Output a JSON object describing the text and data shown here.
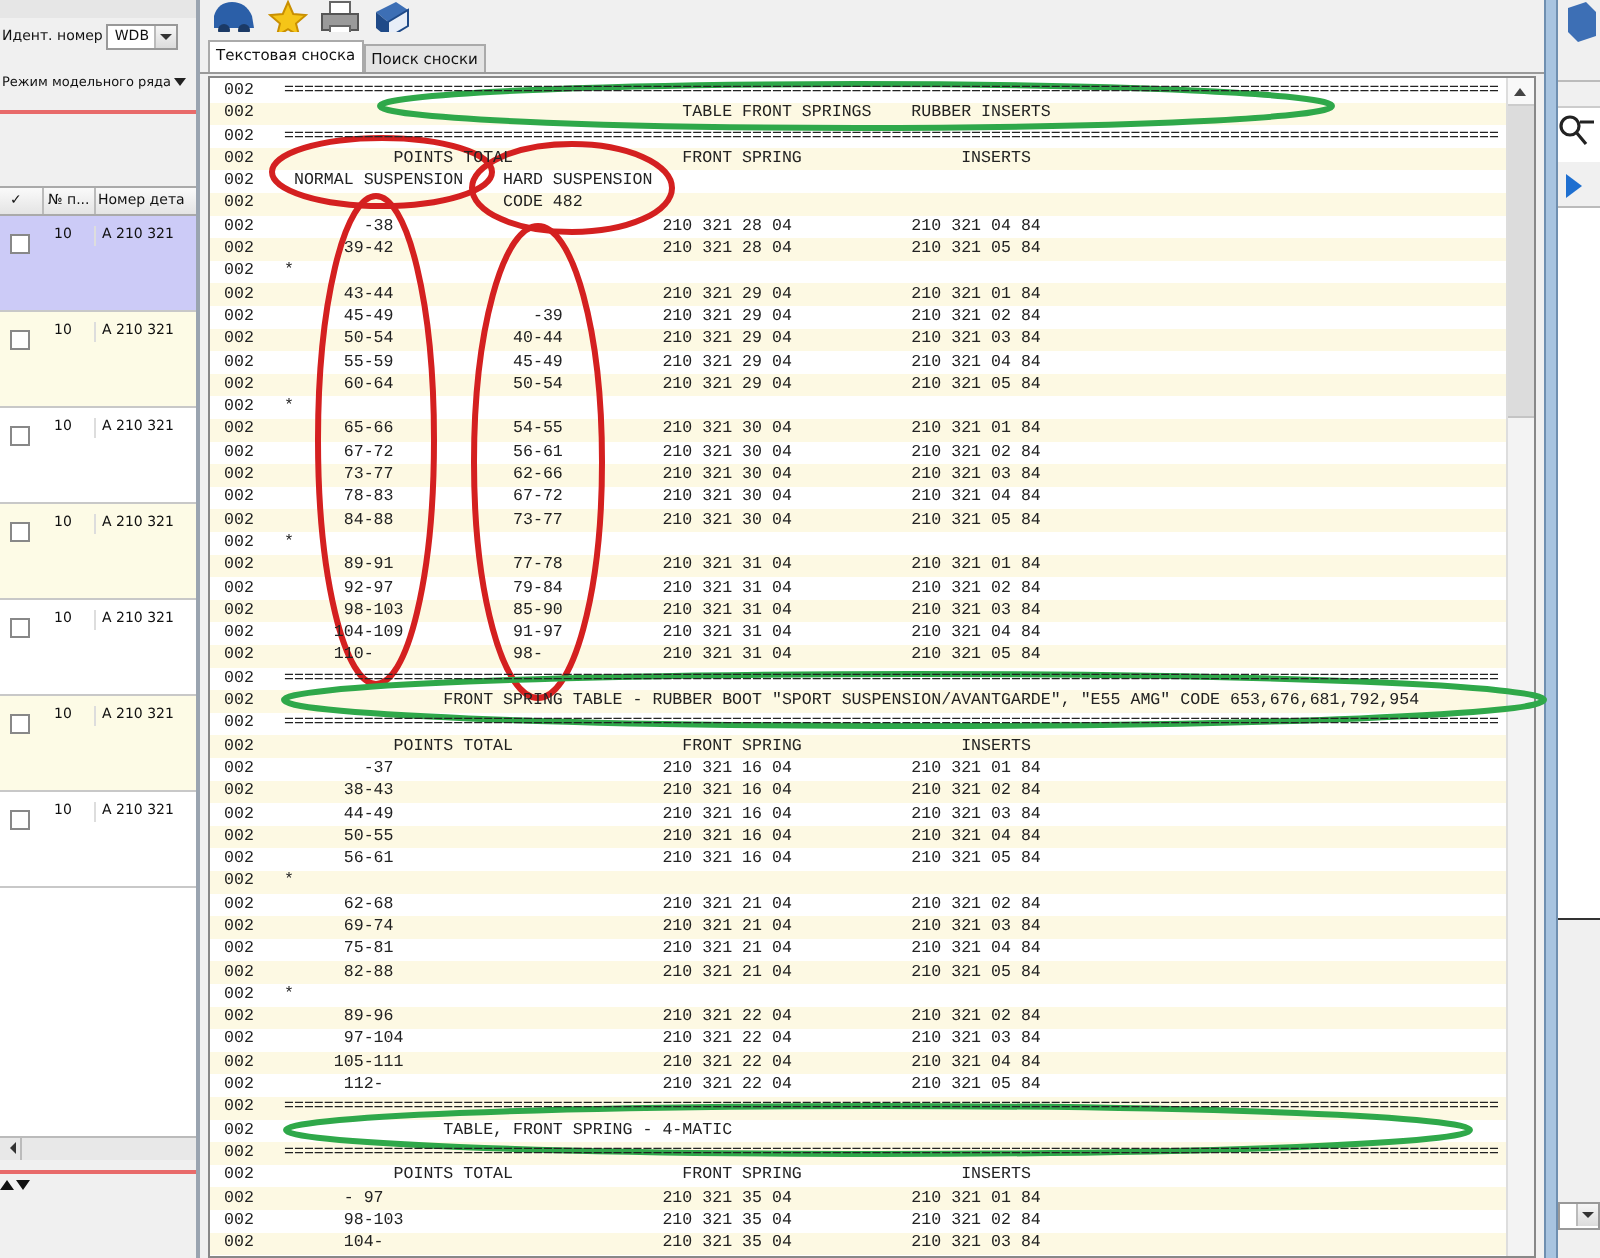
{
  "left_panel": {
    "ident_label": "Идент. номер",
    "ident_value": "WDB",
    "mode_label": "Режим модельного ряда",
    "table": {
      "columns": [
        "✓",
        "№ п...",
        "Номер дета"
      ],
      "rows": [
        {
          "number": "10",
          "part": "A 210 321",
          "checked": false,
          "selected": true
        },
        {
          "number": "10",
          "part": "A 210 321",
          "checked": false,
          "selected": false
        },
        {
          "number": "10",
          "part": "A 210 321",
          "checked": false,
          "selected": false
        },
        {
          "number": "10",
          "part": "A 210 321",
          "checked": false,
          "selected": false
        },
        {
          "number": "10",
          "part": "A 210 321",
          "checked": false,
          "selected": false
        },
        {
          "number": "10",
          "part": "A 210 321",
          "checked": false,
          "selected": false
        },
        {
          "number": "10",
          "part": "A 210 321",
          "checked": false,
          "selected": false
        }
      ]
    }
  },
  "main": {
    "tabs": [
      {
        "label": "Текстовая сноска",
        "selected": true
      },
      {
        "label": "Поиск сноски",
        "selected": false
      }
    ],
    "lines": [
      {
        "code": "002",
        "text": "=========================================================================================================================="
      },
      {
        "code": "002",
        "text": "                                        TABLE FRONT SPRINGS    RUBBER INSERTS"
      },
      {
        "code": "002",
        "text": "=========================================================================================================================="
      },
      {
        "code": "002",
        "text": "           POINTS TOTAL                 FRONT SPRING                INSERTS"
      },
      {
        "code": "002",
        "text": " NORMAL SUSPENSION    HARD SUSPENSION"
      },
      {
        "code": "002",
        "text": "                      CODE 482"
      },
      {
        "code": "002",
        "text": "        -38                           210 321 28 04            210 321 04 84"
      },
      {
        "code": "002",
        "text": "      39-42                           210 321 28 04            210 321 05 84"
      },
      {
        "code": "002",
        "text": "*"
      },
      {
        "code": "002",
        "text": "      43-44                           210 321 29 04            210 321 01 84"
      },
      {
        "code": "002",
        "text": "      45-49              -39          210 321 29 04            210 321 02 84"
      },
      {
        "code": "002",
        "text": "      50-54            40-44          210 321 29 04            210 321 03 84"
      },
      {
        "code": "002",
        "text": "      55-59            45-49          210 321 29 04            210 321 04 84"
      },
      {
        "code": "002",
        "text": "      60-64            50-54          210 321 29 04            210 321 05 84"
      },
      {
        "code": "002",
        "text": "*"
      },
      {
        "code": "002",
        "text": "      65-66            54-55          210 321 30 04            210 321 01 84"
      },
      {
        "code": "002",
        "text": "      67-72            56-61          210 321 30 04            210 321 02 84"
      },
      {
        "code": "002",
        "text": "      73-77            62-66          210 321 30 04            210 321 03 84"
      },
      {
        "code": "002",
        "text": "      78-83            67-72          210 321 30 04            210 321 04 84"
      },
      {
        "code": "002",
        "text": "      84-88            73-77          210 321 30 04            210 321 05 84"
      },
      {
        "code": "002",
        "text": "*"
      },
      {
        "code": "002",
        "text": "      89-91            77-78          210 321 31 04            210 321 01 84"
      },
      {
        "code": "002",
        "text": "      92-97            79-84          210 321 31 04            210 321 02 84"
      },
      {
        "code": "002",
        "text": "      98-103           85-90          210 321 31 04            210 321 03 84"
      },
      {
        "code": "002",
        "text": "     104-109           91-97          210 321 31 04            210 321 04 84"
      },
      {
        "code": "002",
        "text": "     110-              98-            210 321 31 04            210 321 05 84"
      },
      {
        "code": "002",
        "text": "=========================================================================================================================="
      },
      {
        "code": "002",
        "text": "                FRONT SPRING TABLE - RUBBER BOOT \"SPORT SUSPENSION/AVANTGARDE\", \"E55 AMG\" CODE 653,676,681,792,954"
      },
      {
        "code": "002",
        "text": "=========================================================================================================================="
      },
      {
        "code": "002",
        "text": "           POINTS TOTAL                 FRONT SPRING                INSERTS"
      },
      {
        "code": "002",
        "text": "        -37                           210 321 16 04            210 321 01 84"
      },
      {
        "code": "002",
        "text": "      38-43                           210 321 16 04            210 321 02 84"
      },
      {
        "code": "002",
        "text": "      44-49                           210 321 16 04            210 321 03 84"
      },
      {
        "code": "002",
        "text": "      50-55                           210 321 16 04            210 321 04 84"
      },
      {
        "code": "002",
        "text": "      56-61                           210 321 16 04            210 321 05 84"
      },
      {
        "code": "002",
        "text": "*"
      },
      {
        "code": "002",
        "text": "      62-68                           210 321 21 04            210 321 02 84"
      },
      {
        "code": "002",
        "text": "      69-74                           210 321 21 04            210 321 03 84"
      },
      {
        "code": "002",
        "text": "      75-81                           210 321 21 04            210 321 04 84"
      },
      {
        "code": "002",
        "text": "      82-88                           210 321 21 04            210 321 05 84"
      },
      {
        "code": "002",
        "text": "*"
      },
      {
        "code": "002",
        "text": "      89-96                           210 321 22 04            210 321 02 84"
      },
      {
        "code": "002",
        "text": "      97-104                          210 321 22 04            210 321 03 84"
      },
      {
        "code": "002",
        "text": "     105-111                          210 321 22 04            210 321 04 84"
      },
      {
        "code": "002",
        "text": "      112-                            210 321 22 04            210 321 05 84"
      },
      {
        "code": "002",
        "text": "=========================================================================================================================="
      },
      {
        "code": "002",
        "text": "                TABLE, FRONT SPRING - 4-MATIC"
      },
      {
        "code": "002",
        "text": "=========================================================================================================================="
      },
      {
        "code": "002",
        "text": "           POINTS TOTAL                 FRONT SPRING                INSERTS"
      },
      {
        "code": "002",
        "text": "      - 97                            210 321 35 04            210 321 01 84"
      },
      {
        "code": "002",
        "text": "      98-103                          210 321 35 04            210 321 02 84"
      },
      {
        "code": "002",
        "text": "      104-                            210 321 35 04            210 321 03 84"
      }
    ]
  }
}
